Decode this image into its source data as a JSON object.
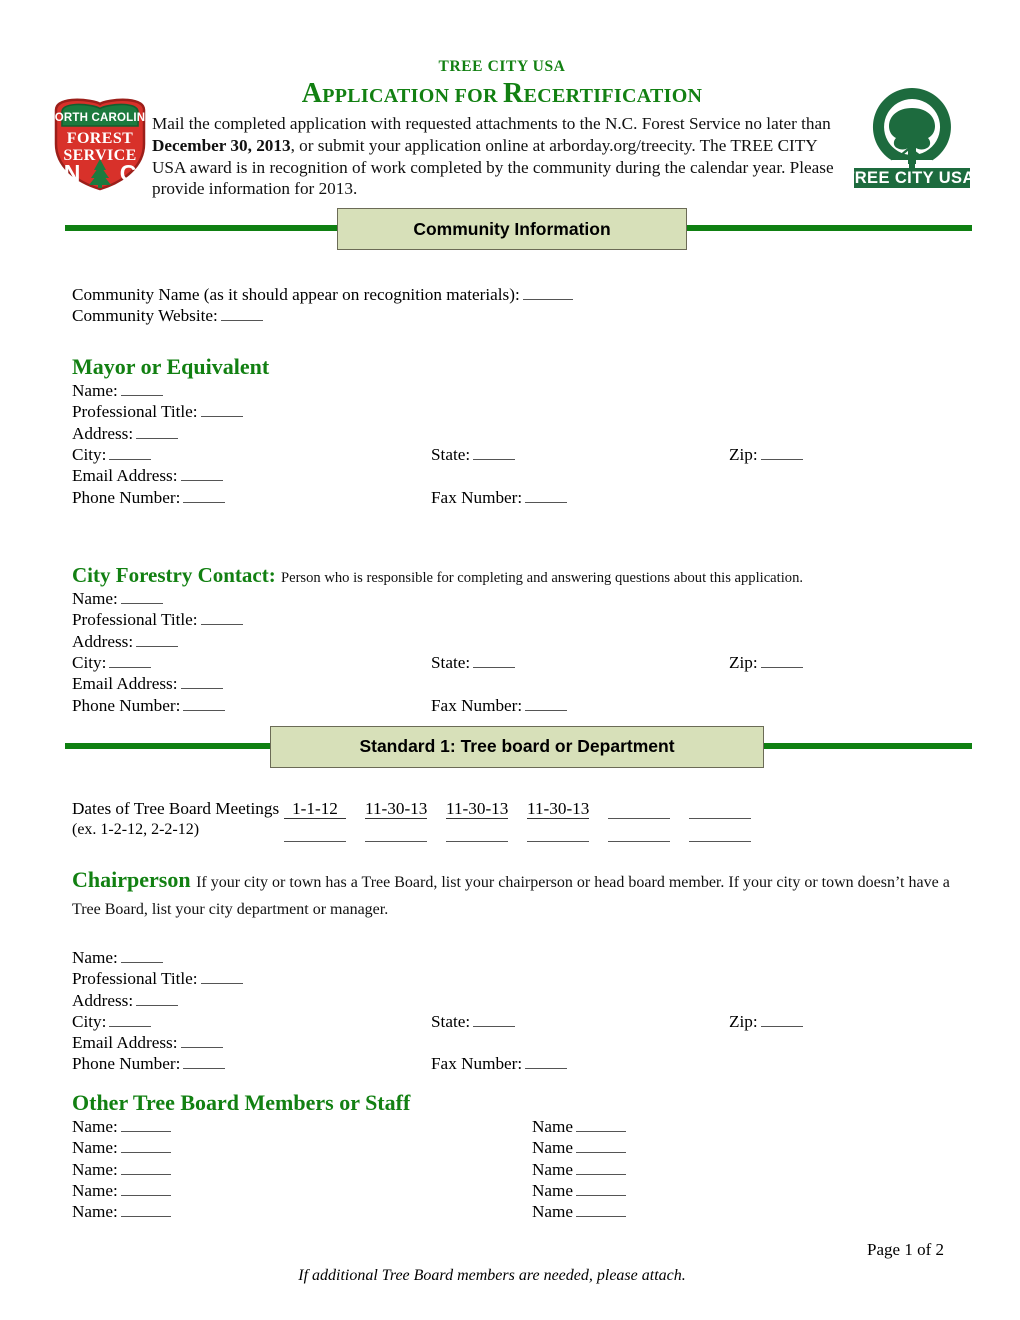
{
  "header": {
    "kicker": "TREE CITY USA",
    "title_part1_cap": "A",
    "title_part1_rest": "PPLICATION FOR ",
    "title_part2_cap": "R",
    "title_part2_rest": "ECERTIFICATION",
    "title_plain": "APPLICATION FOR RECERTIFICATION",
    "intro_line1": "Mail the completed application with requested attachments to the N.C. Forest Service no later than",
    "intro_bold_date": "December 30, 2013",
    "intro_line2_rest": ", or submit your application online at arborday.org/treecity.  The TREE CITY",
    "intro_line3": "USA award is in recognition of work completed by the community during the calendar year.  Please",
    "intro_line4": "provide information for 2013.",
    "nc_logo_alt": "North Carolina Forest Service",
    "nc_logo_banner": "NORTH CAROLINA",
    "nc_logo_word1": "FOREST",
    "nc_logo_word2": "SERVICE",
    "nc_logo_n": "N",
    "nc_logo_c": "C",
    "tc_logo_text": "TREE CITY USA."
  },
  "bands": {
    "community": "Community Information",
    "standard1": "Standard 1: Tree board or Department"
  },
  "community": {
    "name_label": "Community Name (as it should appear on recognition materials):",
    "website_label": "Community Website:"
  },
  "mayor": {
    "heading": "Mayor or Equivalent",
    "name_label": "Name:",
    "title_label": "Professional Title:",
    "address_label": "Address:",
    "city_label": "City:",
    "state_label": "State:",
    "zip_label": "Zip:",
    "email_label": "Email Address:",
    "phone_label": "Phone Number:",
    "fax_label": "Fax Number:"
  },
  "forestry_contact": {
    "heading": "City Forestry Contact:",
    "heading_note": "Person who is responsible for completing and answering questions about this application.",
    "name_label": "Name:",
    "title_label": "Professional Title:",
    "address_label": "Address:",
    "city_label": "City:",
    "state_label": "State:",
    "zip_label": "Zip:",
    "email_label": "Email Address:",
    "phone_label": "Phone Number:",
    "fax_label": "Fax Number:"
  },
  "meetings": {
    "label": "Dates of Tree Board Meetings",
    "example": "(ex. 1-2-12, 2-2-12)",
    "row1": [
      "1-1-12",
      "11-30-13",
      "11-30-13",
      "11-30-13",
      "",
      ""
    ],
    "row2": [
      "",
      "",
      "",
      "",
      "",
      ""
    ]
  },
  "chairperson": {
    "heading": "Chairperson",
    "note": "If your city or town has a Tree Board, list your chairperson or head board member.  If your city or town doesn’t have a Tree Board, list your city department or manager.",
    "name_label": "Name:",
    "title_label": "Professional Title:",
    "address_label": "Address:",
    "city_label": "City:",
    "state_label": "State:",
    "zip_label": "Zip:",
    "email_label": "Email Address:",
    "phone_label": "Phone Number:",
    "fax_label": "Fax Number:"
  },
  "other_members": {
    "heading": "Other Tree Board Members or Staff",
    "left_label": "Name:",
    "right_label": "Name",
    "rows": 5
  },
  "footer": {
    "attach_note": "If additional Tree Board members are needed, please attach.",
    "page_number": "Page 1 of 2"
  },
  "colors": {
    "green_text": "#128012",
    "rule_green": "#0f8012",
    "band_box_fill": "#d7e0b9",
    "band_box_border": "#6b6b56",
    "logo_red": "#d8312a",
    "logo_green": "#1c7a3e"
  }
}
